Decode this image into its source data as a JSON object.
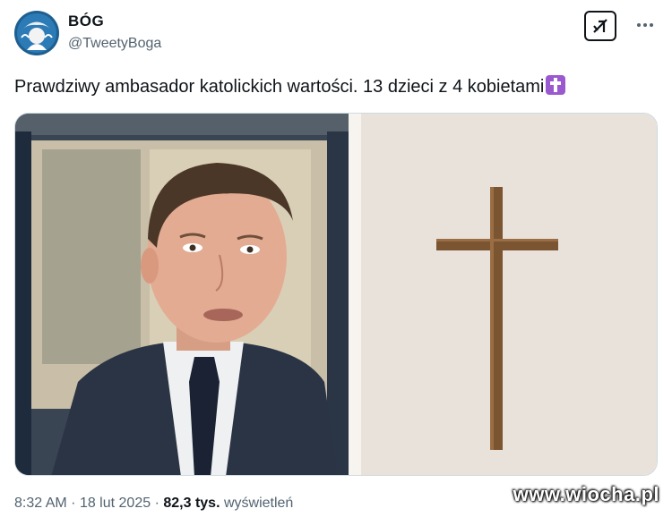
{
  "author": {
    "display_name": "BÓG",
    "handle": "@TweetyBoga"
  },
  "tweet": {
    "text": "Prawdziwy ambasador katolickich wartości. 13 dzieci z 4 kobietami",
    "emoji": "latin-cross-emoji"
  },
  "meta": {
    "time": "8:32 AM",
    "separator": "·",
    "date": "18 lut 2025",
    "views_count": "82,3 tys.",
    "views_label": "wyświetleń"
  },
  "watermark": "www.wiocha.pl",
  "icons": {
    "grok": "grok-icon",
    "more": "more-options-icon"
  },
  "colors": {
    "text": "#0f1419",
    "secondary": "#536471",
    "cross_emoji": "#9b59d0"
  }
}
